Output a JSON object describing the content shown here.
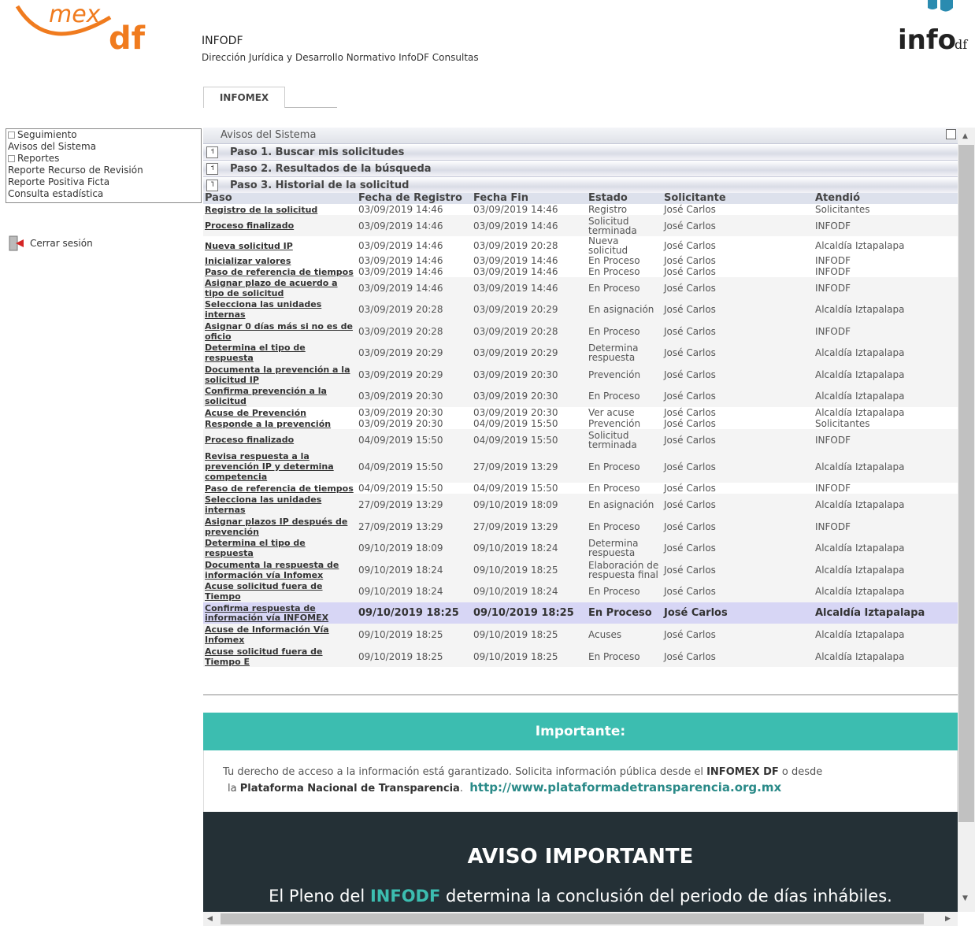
{
  "header": {
    "logo_left_text": "mex df",
    "logo_right_text": "info df",
    "title": "INFODF",
    "subtitle": "Dirección Jurídica y Desarrollo Normativo InfoDF Consultas",
    "tab": "INFOMEX"
  },
  "sidebar": {
    "items": [
      {
        "label": "Seguimiento"
      },
      {
        "label": "Avisos del Sistema"
      },
      {
        "label": "Reportes"
      },
      {
        "label": "Reporte Recurso de Revisión"
      },
      {
        "label": "Reporte Positiva Ficta"
      },
      {
        "label": "Consulta estadística"
      }
    ],
    "logout": "Cerrar sesión"
  },
  "main": {
    "avisos_title": "Avisos del Sistema",
    "paso1": "Paso 1. Buscar mis solicitudes",
    "paso2": "Paso 2. Resultados de la búsqueda",
    "paso3": "Paso 3. Historial de la solicitud",
    "columns": {
      "paso": "Paso",
      "fecha_registro": "Fecha de Registro",
      "fecha_fin": "Fecha Fin",
      "estado": "Estado",
      "solicitante": "Solicitante",
      "atendio": "Atendió"
    },
    "rows": [
      {
        "paso": "Registro de la solicitud",
        "fr": "03/09/2019 14:46",
        "ff": "03/09/2019 14:46",
        "estado": "Registro",
        "sol": "José Carlos",
        "at": "Solicitantes",
        "h": 14
      },
      {
        "paso": "Proceso finalizado",
        "fr": "03/09/2019 14:46",
        "ff": "03/09/2019 14:46",
        "estado": "Solicitud terminada",
        "sol": "José Carlos",
        "at": "INFODF",
        "h": 27
      },
      {
        "paso": "Nueva solicitud IP",
        "fr": "03/09/2019 14:46",
        "ff": "03/09/2019 20:28",
        "estado": "Nueva solicitud",
        "sol": "José Carlos",
        "at": "Alcaldía Iztapalapa",
        "h": 14
      },
      {
        "paso": "Inicializar valores",
        "fr": "03/09/2019 14:46",
        "ff": "03/09/2019 14:46",
        "estado": "En Proceso",
        "sol": "José Carlos",
        "at": "INFODF",
        "h": 14
      },
      {
        "paso": "Paso de referencia de tiempos",
        "fr": "03/09/2019 14:46",
        "ff": "03/09/2019 14:46",
        "estado": "En Proceso",
        "sol": "José Carlos",
        "at": "INFODF",
        "h": 14
      },
      {
        "paso": "Asignar plazo de acuerdo a tipo de solicitud",
        "fr": "03/09/2019 14:46",
        "ff": "03/09/2019 14:46",
        "estado": "En Proceso",
        "sol": "José Carlos",
        "at": "INFODF",
        "h": 27
      },
      {
        "paso": "Selecciona las unidades internas",
        "fr": "03/09/2019 20:28",
        "ff": "03/09/2019 20:29",
        "estado": "En asignación",
        "sol": "José Carlos",
        "at": "Alcaldía Iztapalapa",
        "h": 28
      },
      {
        "paso": "Asignar 0 días más si no es de oficio",
        "fr": "03/09/2019 20:28",
        "ff": "03/09/2019 20:28",
        "estado": "En Proceso",
        "sol": "José Carlos",
        "at": "INFODF",
        "h": 27
      },
      {
        "paso": "Determina el tipo de respuesta",
        "fr": "03/09/2019 20:29",
        "ff": "03/09/2019 20:29",
        "estado": "Determina respuesta",
        "sol": "José Carlos",
        "at": "Alcaldía Iztapalapa",
        "h": 28
      },
      {
        "paso": "Documenta la prevención a la solicitud IP",
        "fr": "03/09/2019 20:29",
        "ff": "03/09/2019 20:30",
        "estado": "Prevención",
        "sol": "José Carlos",
        "at": "Alcaldía Iztapalapa",
        "h": 27
      },
      {
        "paso": "Confirma prevención a la solicitud",
        "fr": "03/09/2019 20:30",
        "ff": "03/09/2019 20:30",
        "estado": "En Proceso",
        "sol": "José Carlos",
        "at": "Alcaldía Iztapalapa",
        "h": 28
      },
      {
        "paso": "Acuse de Prevención",
        "fr": "03/09/2019 20:30",
        "ff": "03/09/2019 20:30",
        "estado": "Ver acuse",
        "sol": "José Carlos",
        "at": "Alcaldía Iztapalapa",
        "h": 14
      },
      {
        "paso": "Responde a la prevención",
        "fr": "03/09/2019 20:30",
        "ff": "04/09/2019 15:50",
        "estado": "Prevención",
        "sol": "José Carlos",
        "at": "Solicitantes",
        "h": 14
      },
      {
        "paso": "Proceso finalizado",
        "fr": "04/09/2019 15:50",
        "ff": "04/09/2019 15:50",
        "estado": "Solicitud terminada",
        "sol": "José Carlos",
        "at": "INFODF",
        "h": 27
      },
      {
        "paso": "Revisa respuesta a la prevención IP y determina competencia",
        "fr": "04/09/2019 15:50",
        "ff": "27/09/2019 13:29",
        "estado": "En Proceso",
        "sol": "José Carlos",
        "at": "Alcaldía Iztapalapa",
        "h": 41
      },
      {
        "paso": "Paso de referencia de tiempos",
        "fr": "04/09/2019 15:50",
        "ff": "04/09/2019 15:50",
        "estado": "En Proceso",
        "sol": "José Carlos",
        "at": "INFODF",
        "h": 14
      },
      {
        "paso": "Selecciona las unidades internas",
        "fr": "27/09/2019 13:29",
        "ff": "09/10/2019 18:09",
        "estado": "En asignación",
        "sol": "José Carlos",
        "at": "Alcaldía Iztapalapa",
        "h": 28
      },
      {
        "paso": "Asignar plazos IP después de prevención",
        "fr": "27/09/2019 13:29",
        "ff": "27/09/2019 13:29",
        "estado": "En Proceso",
        "sol": "José Carlos",
        "at": "INFODF",
        "h": 27
      },
      {
        "paso": "Determina el tipo de respuesta",
        "fr": "09/10/2019 18:09",
        "ff": "09/10/2019 18:24",
        "estado": "Determina respuesta",
        "sol": "José Carlos",
        "at": "Alcaldía Iztapalapa",
        "h": 28
      },
      {
        "paso": "Documenta la respuesta de información vía Infomex",
        "fr": "09/10/2019 18:24",
        "ff": "09/10/2019 18:25",
        "estado": "Elaboración de respuesta final",
        "sol": "José Carlos",
        "at": "Alcaldía Iztapalapa",
        "h": 27
      },
      {
        "paso": "Acuse solicitud fuera de Tiempo",
        "fr": "09/10/2019 18:24",
        "ff": "09/10/2019 18:24",
        "estado": "En Proceso",
        "sol": "José Carlos",
        "at": "Alcaldía Iztapalapa",
        "h": 28
      },
      {
        "paso": "Confirma respuesta de información vía INFOMEX",
        "fr": "09/10/2019 18:25",
        "ff": "09/10/2019 18:25",
        "estado": "En Proceso",
        "sol": "José Carlos",
        "at": "Alcaldía Iztapalapa",
        "h": 27,
        "highlight": true
      },
      {
        "paso": "Acuse de Información Vía Infomex",
        "fr": "09/10/2019 18:25",
        "ff": "09/10/2019 18:25",
        "estado": "Acuses",
        "sol": "José Carlos",
        "at": "Alcaldía Iztapalapa",
        "h": 28
      },
      {
        "paso": "Acuse solicitud fuera de Tiempo E",
        "fr": "09/10/2019 18:25",
        "ff": "09/10/2019 18:25",
        "estado": "En Proceso",
        "sol": "José Carlos",
        "at": "Alcaldía Iztapalapa",
        "h": 27
      }
    ]
  },
  "importante": {
    "title": "Importante:",
    "text1": "Tu derecho de acceso a la información está garantizado. Solicita información pública desde el",
    "infomex": "INFOMEX DF",
    "text2": "o desde",
    "text3": "la",
    "plataforma": "Plataforma Nacional de Transparencia",
    "url": "http://www.plataformadetransparencia.org.mx"
  },
  "aviso": {
    "title": "AVISO IMPORTANTE",
    "text1": "El Pleno del",
    "infodf": "INFODF",
    "text2": "determina la conclusión del periodo de días inhábiles."
  },
  "colors": {
    "accent_teal": "#3cbdb0",
    "dark_banner": "#243036",
    "highlight_row": "#d7d6f5",
    "logo_orange": "#f07b1e",
    "logo_teal": "#2a8bb0"
  }
}
